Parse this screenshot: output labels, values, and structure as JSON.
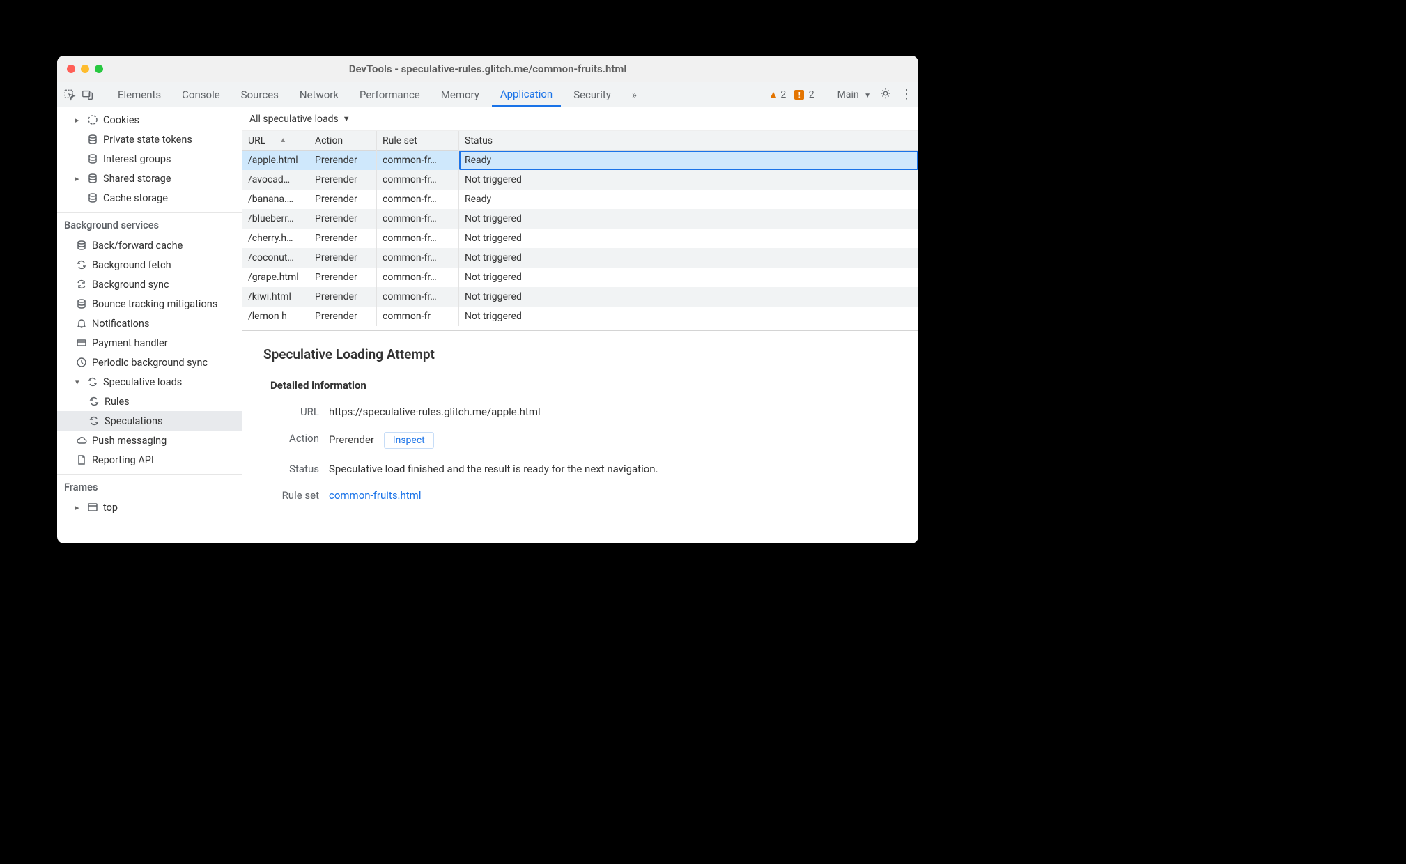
{
  "window": {
    "title": "DevTools - speculative-rules.glitch.me/common-fruits.html"
  },
  "panels": {
    "elements": "Elements",
    "console": "Console",
    "sources": "Sources",
    "network": "Network",
    "performance": "Performance",
    "memory": "Memory",
    "application": "Application",
    "security": "Security",
    "overflow": "»"
  },
  "warnings": {
    "triangle_count": "2",
    "square_count": "2"
  },
  "context": {
    "main_label": "Main"
  },
  "sidebar": {
    "storage": {
      "cookies": "Cookies",
      "pst": "Private state tokens",
      "interest": "Interest groups",
      "shared": "Shared storage",
      "cache": "Cache storage"
    },
    "bg_title": "Background services",
    "bg": {
      "bfc": "Back/forward cache",
      "bf": "Background fetch",
      "bs": "Background sync",
      "bounce": "Bounce tracking mitigations",
      "notif": "Notifications",
      "payment": "Payment handler",
      "periodic": "Periodic background sync",
      "spec": "Speculative loads",
      "rules": "Rules",
      "speculations": "Speculations",
      "push": "Push messaging",
      "reporting": "Reporting API"
    },
    "frames_title": "Frames",
    "frames": {
      "top": "top"
    }
  },
  "filter": {
    "label": "All speculative loads"
  },
  "table": {
    "headers": {
      "url": "URL",
      "action": "Action",
      "ruleset": "Rule set",
      "status": "Status"
    },
    "rows": [
      {
        "url": "/apple.html",
        "action": "Prerender",
        "ruleset": "common-fr…",
        "status": "Ready"
      },
      {
        "url": "/avocad…",
        "action": "Prerender",
        "ruleset": "common-fr…",
        "status": "Not triggered"
      },
      {
        "url": "/banana.…",
        "action": "Prerender",
        "ruleset": "common-fr…",
        "status": "Ready"
      },
      {
        "url": "/blueberr…",
        "action": "Prerender",
        "ruleset": "common-fr…",
        "status": "Not triggered"
      },
      {
        "url": "/cherry.h…",
        "action": "Prerender",
        "ruleset": "common-fr…",
        "status": "Not triggered"
      },
      {
        "url": "/coconut…",
        "action": "Prerender",
        "ruleset": "common-fr…",
        "status": "Not triggered"
      },
      {
        "url": "/grape.html",
        "action": "Prerender",
        "ruleset": "common-fr…",
        "status": "Not triggered"
      },
      {
        "url": "/kiwi.html",
        "action": "Prerender",
        "ruleset": "common-fr…",
        "status": "Not triggered"
      },
      {
        "url": "/lemon h",
        "action": "Prerender",
        "ruleset": "common-fr",
        "status": "Not triggered"
      }
    ]
  },
  "detail": {
    "heading": "Speculative Loading Attempt",
    "section": "Detailed information",
    "labels": {
      "url": "URL",
      "action": "Action",
      "status": "Status",
      "ruleset": "Rule set"
    },
    "url": "https://speculative-rules.glitch.me/apple.html",
    "action": "Prerender",
    "inspect": "Inspect",
    "status": "Speculative load finished and the result is ready for the next navigation.",
    "ruleset": "common-fruits.html"
  }
}
